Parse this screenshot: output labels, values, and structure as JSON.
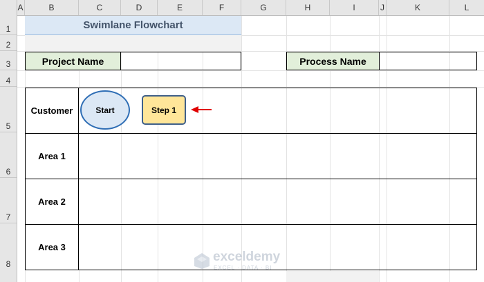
{
  "columns": [
    "A",
    "B",
    "C",
    "D",
    "E",
    "F",
    "G",
    "H",
    "I",
    "J",
    "K",
    "L"
  ],
  "rows": [
    "1",
    "2",
    "3",
    "4",
    "5",
    "6",
    "7",
    "8"
  ],
  "title": "Swimlane Flowchart",
  "project_name_label": "Project Name",
  "process_name_label": "Process Name",
  "lanes": [
    "Customer",
    "Area 1",
    "Area 2",
    "Area 3"
  ],
  "shapes": {
    "start": "Start",
    "step1": "Step 1"
  },
  "watermark": {
    "name": "exceldemy",
    "tagline": "EXCEL · DATA · BI"
  },
  "colors": {
    "title_bg": "#dce8f5",
    "label_green": "#e2efda",
    "step_fill": "#ffe699",
    "arrow": "#e00000"
  }
}
